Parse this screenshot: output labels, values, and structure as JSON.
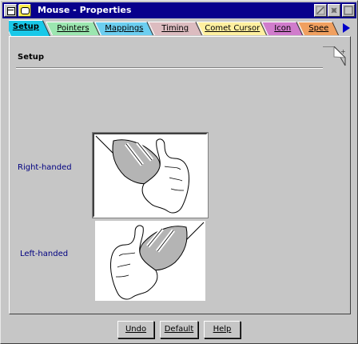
{
  "window": {
    "title": "Mouse - Properties",
    "title_bar_color": "#08008c"
  },
  "tabs": [
    {
      "label": "Setup",
      "color": "#18c8e8",
      "active": true
    },
    {
      "label": "Pointers",
      "color": "#9ce6b0",
      "active": false
    },
    {
      "label": "Mappings",
      "color": "#6ccef0",
      "active": false
    },
    {
      "label": "Timing",
      "color": "#dcbcc0",
      "active": false
    },
    {
      "label": "Comet Cursor",
      "color": "#fff0a0",
      "active": false
    },
    {
      "label": "Icon",
      "color": "#d07ccc",
      "active": false
    },
    {
      "label": "Spee",
      "color": "#f0a060",
      "active": false
    }
  ],
  "page": {
    "title": "Setup",
    "options": [
      {
        "label": "Right-handed",
        "selected": true
      },
      {
        "label": "Left-handed",
        "selected": false
      }
    ]
  },
  "buttons": {
    "undo": "Undo",
    "default": "Default",
    "help": "Help"
  },
  "icons": {
    "system_menu": "system-menu-icon",
    "app": "speech-bubble-icon",
    "hide": "hide-icon",
    "restore": "restore-icon",
    "close": "close-icon",
    "tab_scroll": "arrow-right-icon",
    "page_turn": "page-turn-icon"
  }
}
